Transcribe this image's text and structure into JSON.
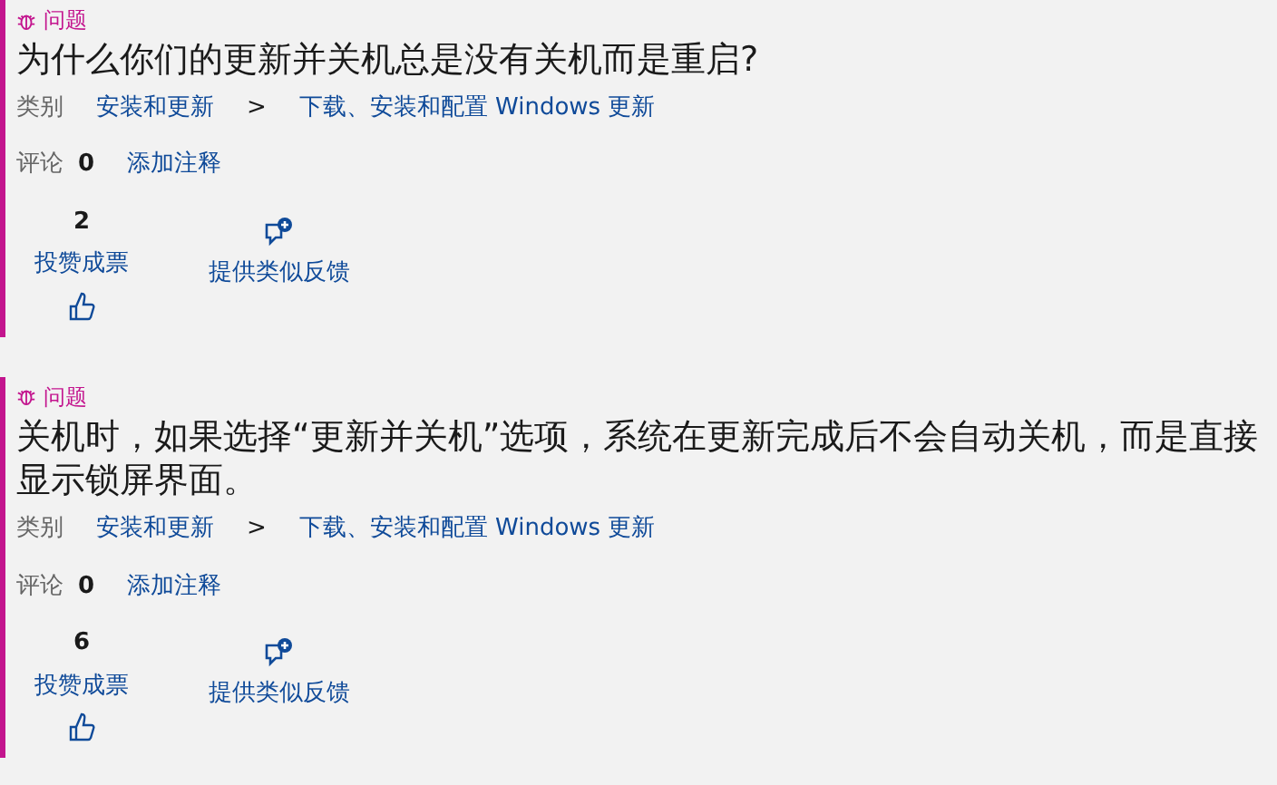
{
  "items": [
    {
      "type_label": "问题",
      "title": "为什么你们的更新并关机总是没有关机而是重启?",
      "category_label": "类别",
      "breadcrumbs": [
        "安装和更新",
        ">",
        "下载、安装和配置 Windows 更新"
      ],
      "comments_label": "评论",
      "comments_count": "0",
      "add_comment": "添加注释",
      "votes": "2",
      "vote_link": "投赞成票",
      "feedback_link": "提供类似反馈"
    },
    {
      "type_label": "问题",
      "title": "关机时，如果选择“更新并关机”选项，系统在更新完成后不会自动关机，而是直接显示锁屏界面。",
      "category_label": "类别",
      "breadcrumbs": [
        "安装和更新",
        ">",
        "下载、安装和配置 Windows 更新"
      ],
      "comments_label": "评论",
      "comments_count": "0",
      "add_comment": "添加注释",
      "votes": "6",
      "vote_link": "投赞成票",
      "feedback_link": "提供类似反馈"
    }
  ]
}
